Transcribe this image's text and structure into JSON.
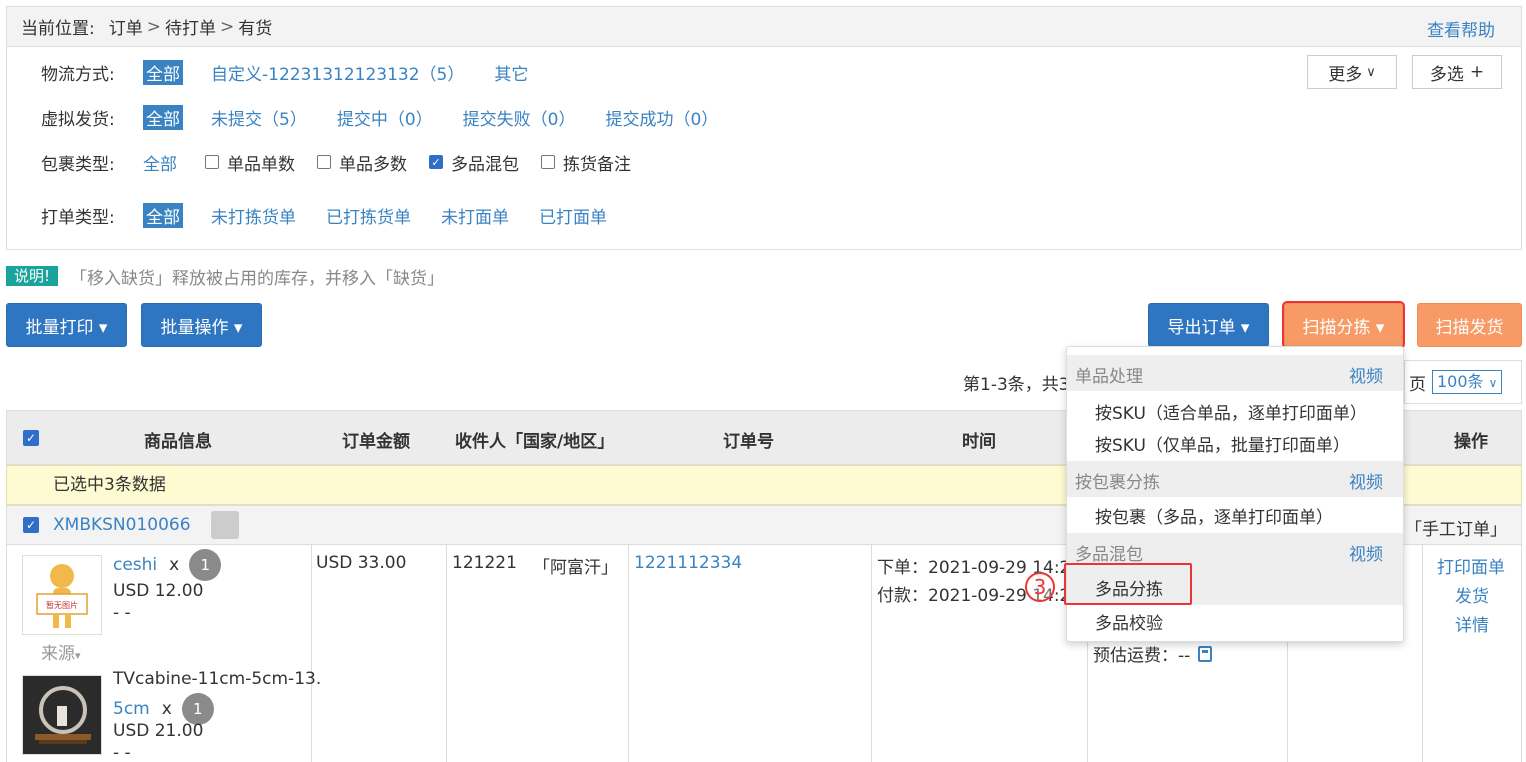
{
  "breadcrumb": {
    "label": "当前位置:",
    "items": [
      "订单",
      "待打单",
      "有货"
    ],
    "sep": ">",
    "help": "查看帮助"
  },
  "filters": {
    "logistics": {
      "label": "物流方式:",
      "options": [
        "全部",
        "自定义-12231312123132（5）",
        "其它"
      ]
    },
    "virtual": {
      "label": "虚拟发货:",
      "options": [
        "全部",
        "未提交（5）",
        "提交中（0）",
        "提交失败（0）",
        "提交成功（0）"
      ]
    },
    "package": {
      "label": "包裹类型:",
      "all": "全部",
      "checks": [
        {
          "label": "单品单数",
          "checked": false
        },
        {
          "label": "单品多数",
          "checked": false
        },
        {
          "label": "多品混包",
          "checked": true
        },
        {
          "label": "拣货备注",
          "checked": false
        }
      ]
    },
    "print": {
      "label": "打单类型:",
      "options": [
        "全部",
        "未打拣货单",
        "已打拣货单",
        "未打面单",
        "已打面单"
      ]
    },
    "more": "更多",
    "multi": "多选"
  },
  "note": {
    "tag": "说明!",
    "text": "「移入缺货」释放被占用的库存，并移入「缺货」"
  },
  "actions": {
    "batch_print": "批量打印 ▾",
    "batch_ops": "批量操作 ▾",
    "export": "导出订单 ▾",
    "scan_sort": "扫描分拣 ▾",
    "scan_ship": "扫描发货"
  },
  "pager": {
    "left": "第1-3条，共3",
    "suffix": "页",
    "per_page": "100条"
  },
  "table": {
    "headers": [
      "商品信息",
      "订单金额",
      "收件人「国家/地区」",
      "订单号",
      "时间",
      "操作"
    ],
    "selected_text": "已选中3条数据",
    "order": {
      "id": "XMBKSN010066",
      "type": "「手工订单」",
      "amount": "USD 33.00",
      "recipient": "121221",
      "country": "「阿富汗」",
      "order_no": "1221112334",
      "time_order": "下单：2021-09-29 14:25",
      "time_pay": "付款：2021-09-29 14:25",
      "shipping_est": "预估运费：--",
      "ops": [
        "打印面单",
        "发货",
        "详情"
      ],
      "items": [
        {
          "name": "ceshi",
          "qty_x": "x",
          "qty": "1",
          "price": "USD 12.00",
          "sku": "- -",
          "source": "来源",
          "thumb_text": "暂无图片"
        },
        {
          "name": "TVcabine-11cm-5cm-13.",
          "name2": "5cm",
          "qty_x": "x",
          "qty": "1",
          "price": "USD 21.00",
          "sku": "- -"
        }
      ]
    }
  },
  "dropdown": {
    "groups": [
      {
        "title": "单品处理",
        "video": "视频",
        "items": [
          "按SKU（适合单品，逐单打印面单）",
          "按SKU（仅单品，批量打印面单）"
        ]
      },
      {
        "title": "按包裹分拣",
        "video": "视频",
        "items": [
          "按包裹（多品，逐单打印面单）"
        ]
      },
      {
        "title": "多品混包",
        "video": "视频",
        "items": [
          "多品分拣",
          "多品校验"
        ]
      }
    ]
  },
  "annotation": {
    "step": "3"
  },
  "colors": {
    "primary": "#2f76c2",
    "accent": "#f79a66",
    "link": "#3a83c3",
    "highlight": "#e33333"
  }
}
